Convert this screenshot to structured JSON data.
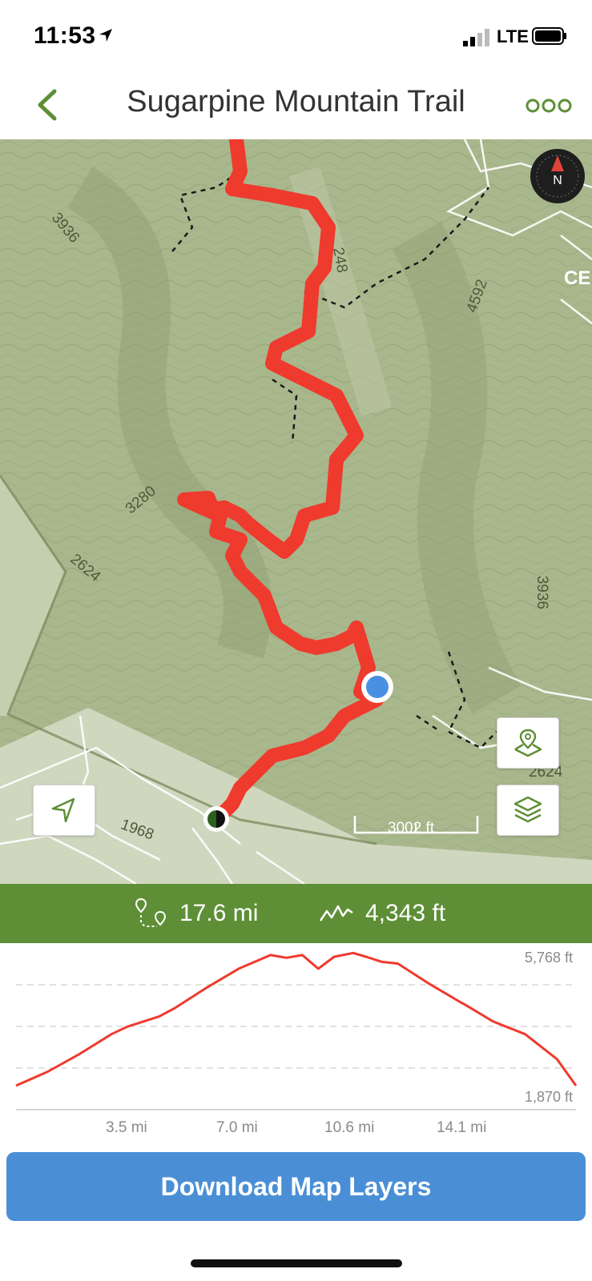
{
  "status": {
    "time": "11:53",
    "carrier": "LTE"
  },
  "nav": {
    "title": "Sugarpine Mountain Trail",
    "back_icon": "chevron-left-icon",
    "more_icon": "more-dots-icon"
  },
  "map": {
    "contour_labels": [
      "3936",
      "3280",
      "2624",
      "4592",
      "3936",
      "1968",
      "2624",
      "248",
      "CE"
    ],
    "scale_label": "3002 ft",
    "compass_label": "N",
    "accent": "#5e8f37",
    "trail_color": "#ef3a2e"
  },
  "stats": {
    "distance": "17.6 mi",
    "elevation_gain": "4,343 ft"
  },
  "profile": {
    "max_label": "5,768 ft",
    "min_label": "1,870 ft",
    "x_ticks": [
      "3.5 mi",
      "7.0 mi",
      "10.6 mi",
      "14.1 mi"
    ]
  },
  "chart_data": {
    "type": "line",
    "title": "",
    "xlabel": "",
    "ylabel": "",
    "x_unit": "mi",
    "y_unit": "ft",
    "xlim": [
      0,
      17.6
    ],
    "ylim": [
      1870,
      5768
    ],
    "series": [
      {
        "x": [
          0,
          1,
          2,
          3,
          3.5,
          4.5,
          5,
          6,
          7,
          7.5,
          8,
          8.5,
          9,
          9.5,
          10,
          10.6,
          11,
          11.5,
          12,
          13,
          14,
          14.1,
          15,
          16,
          17,
          17.6
        ],
        "values": [
          1870,
          2280,
          2800,
          3380,
          3600,
          3900,
          4150,
          4750,
          5300,
          5500,
          5700,
          5620,
          5700,
          5300,
          5650,
          5760,
          5650,
          5500,
          5450,
          4850,
          4300,
          4250,
          3750,
          3380,
          2650,
          1870
        ]
      }
    ]
  },
  "actions": {
    "download_label": "Download Map Layers"
  }
}
